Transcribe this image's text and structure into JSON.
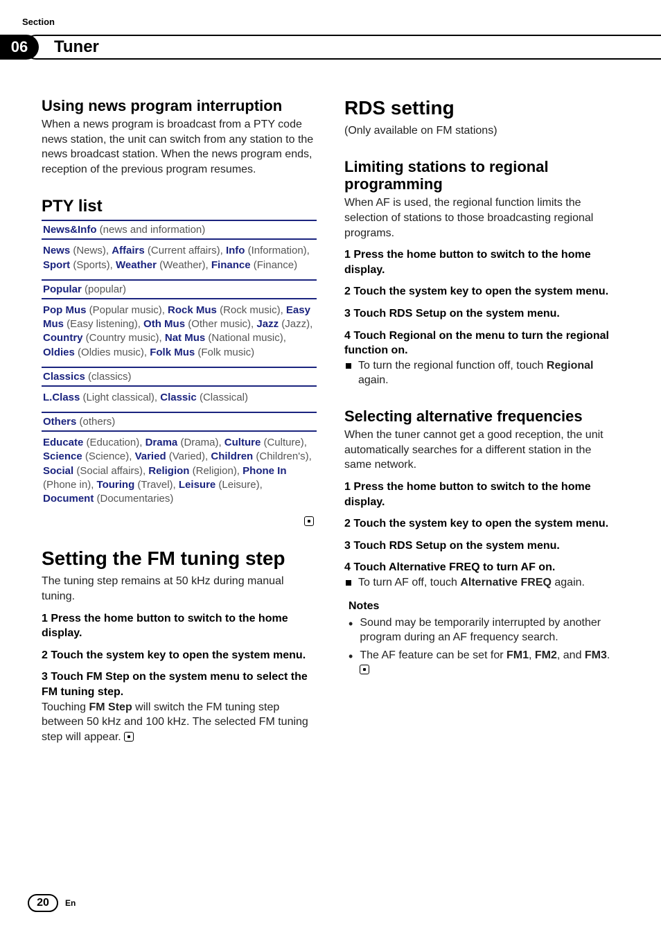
{
  "header": {
    "section_label": "Section",
    "section_number": "06",
    "title": "Tuner"
  },
  "left": {
    "h_news": "Using news program interruption",
    "p_news": "When a news program is broadcast from a PTY code news station, the unit can switch from any station to the news broadcast station. When the news program ends, reception of the previous program resumes.",
    "h_pty": "PTY list",
    "pty": [
      {
        "head_b": "News&Info",
        "head_g": " (news and information)",
        "body": [
          {
            "b": "News",
            "g": " (News), "
          },
          {
            "b": "Affairs",
            "g": " (Current affairs), "
          },
          {
            "b": "Info",
            "g": " (Information), "
          },
          {
            "b": "Sport",
            "g": " (Sports), "
          },
          {
            "b": "Weather",
            "g": " (Weather), "
          },
          {
            "b": "Finance",
            "g": " (Finance)"
          }
        ]
      },
      {
        "head_b": "Popular",
        "head_g": " (popular)",
        "body": [
          {
            "b": "Pop Mus",
            "g": " (Popular music), "
          },
          {
            "b": "Rock Mus",
            "g": " (Rock music), "
          },
          {
            "b": "Easy Mus",
            "g": " (Easy listening), "
          },
          {
            "b": "Oth Mus",
            "g": " (Other music), "
          },
          {
            "b": "Jazz",
            "g": " (Jazz), "
          },
          {
            "b": "Country",
            "g": " (Country music), "
          },
          {
            "b": "Nat Mus",
            "g": " (National music), "
          },
          {
            "b": "Oldies",
            "g": " (Oldies music), "
          },
          {
            "b": "Folk Mus",
            "g": " (Folk music)"
          }
        ]
      },
      {
        "head_b": "Classics",
        "head_g": " (classics)",
        "body": [
          {
            "b": "L.Class",
            "g": " (Light classical), "
          },
          {
            "b": "Classic",
            "g": " (Classical)"
          }
        ]
      },
      {
        "head_b": "Others",
        "head_g": " (others)",
        "body": [
          {
            "b": "Educate",
            "g": " (Education), "
          },
          {
            "b": "Drama",
            "g": " (Drama), "
          },
          {
            "b": "Culture",
            "g": " (Culture), "
          },
          {
            "b": "Science",
            "g": " (Science), "
          },
          {
            "b": "Varied",
            "g": " (Varied), "
          },
          {
            "b": "Children",
            "g": " (Children's), "
          },
          {
            "b": "Social",
            "g": " (Social affairs), "
          },
          {
            "b": "Religion",
            "g": " (Religion), "
          },
          {
            "b": "Phone In",
            "g": " (Phone in), "
          },
          {
            "b": "Touring",
            "g": " (Travel), "
          },
          {
            "b": "Leisure",
            "g": " (Leisure), "
          },
          {
            "b": "Document",
            "g": " (Documentaries)"
          }
        ]
      }
    ],
    "h_fm": "Setting the FM tuning step",
    "p_fm": "The tuning step remains at 50 kHz during manual tuning.",
    "steps_fm": [
      "1    Press the home button to switch to the home display.",
      "2    Touch the system key to open the system menu.",
      "3    Touch FM Step on the system menu to select the FM tuning step."
    ],
    "p_fm2a": "Touching ",
    "p_fm2b": "FM Step",
    "p_fm2c": " will switch the FM tuning step between 50 kHz and 100 kHz. The selected FM tuning step will appear."
  },
  "right": {
    "h_rds": "RDS setting",
    "p_rds": "(Only available on FM stations)",
    "h_reg": "Limiting stations to regional programming",
    "p_reg": "When AF is used, the regional function limits the selection of stations to those broadcasting regional programs.",
    "steps_reg": [
      "1    Press the home button to switch to the home display.",
      "2    Touch the system key to open the system menu.",
      "3    Touch RDS Setup on the system menu.",
      "4    Touch Regional on the menu to turn the regional function on."
    ],
    "reg_note_a": "To turn the regional function off, touch ",
    "reg_note_b": "Regional",
    "reg_note_c": " again.",
    "h_af": "Selecting alternative frequencies",
    "p_af": "When the tuner cannot get a good reception, the unit automatically searches for a different station in the same network.",
    "steps_af": [
      "1    Press the home button to switch to the home display.",
      "2    Touch the system key to open the system menu.",
      "3    Touch RDS Setup on the system menu.",
      "4    Touch Alternative FREQ to turn AF on."
    ],
    "af_note_a": "To turn AF off, touch ",
    "af_note_b": "Alternative FREQ",
    "af_note_c": " again.",
    "notes_title": "Notes",
    "notes": [
      {
        "pre": "Sound may be temporarily interrupted by another program during an AF frequency search.",
        "bold": "",
        "post": ""
      },
      {
        "pre": "The AF feature can be set for ",
        "bold": "FM1",
        "mid": ", ",
        "bold2": "FM2",
        "mid2": ", and ",
        "bold3": "FM3",
        "post": "."
      }
    ]
  },
  "footer": {
    "page": "20",
    "lang": "En"
  }
}
